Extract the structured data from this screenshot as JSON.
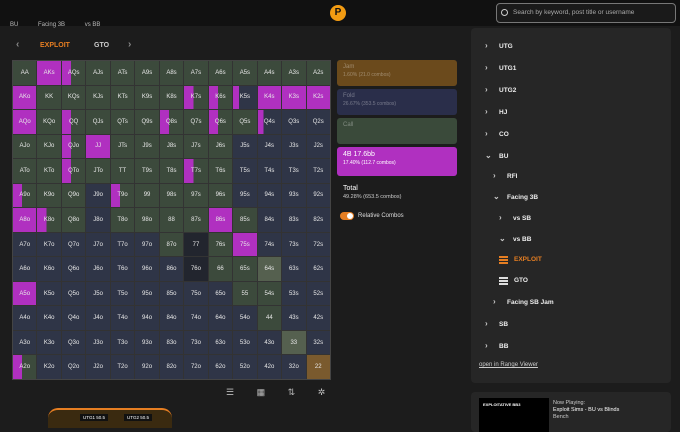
{
  "header": {
    "logo": "P",
    "search_placeholder": "Search by keyword, post title or username"
  },
  "breadcrumb": [
    "BU",
    "Facing 3B",
    "vs BB"
  ],
  "tabs": [
    "EXPLOIT",
    "GTO"
  ],
  "grid": [
    [
      "AA",
      "AKs",
      "AQs",
      "AJs",
      "ATs",
      "A9s",
      "A8s",
      "A7s",
      "A6s",
      "A5s",
      "A4s",
      "A3s",
      "A2s"
    ],
    [
      "AKo",
      "KK",
      "KQs",
      "KJs",
      "KTs",
      "K9s",
      "K8s",
      "K7s",
      "K6s",
      "K5s",
      "K4s",
      "K3s",
      "K2s"
    ],
    [
      "AQo",
      "KQo",
      "QQ",
      "QJs",
      "QTs",
      "Q9s",
      "Q8s",
      "Q7s",
      "Q6s",
      "Q5s",
      "Q4s",
      "Q3s",
      "Q2s"
    ],
    [
      "AJo",
      "KJo",
      "QJo",
      "JJ",
      "JTs",
      "J9s",
      "J8s",
      "J7s",
      "J6s",
      "J5s",
      "J4s",
      "J3s",
      "J2s"
    ],
    [
      "ATo",
      "KTo",
      "QTo",
      "JTo",
      "TT",
      "T9s",
      "T8s",
      "T7s",
      "T6s",
      "T5s",
      "T4s",
      "T3s",
      "T2s"
    ],
    [
      "A9o",
      "K9o",
      "Q9o",
      "J9o",
      "T9o",
      "99",
      "98s",
      "97s",
      "96s",
      "95s",
      "94s",
      "93s",
      "92s"
    ],
    [
      "A8o",
      "K8o",
      "Q8o",
      "J8o",
      "T8o",
      "98o",
      "88",
      "87s",
      "86s",
      "85s",
      "84s",
      "83s",
      "82s"
    ],
    [
      "A7o",
      "K7o",
      "Q7o",
      "J7o",
      "T7o",
      "97o",
      "87o",
      "77",
      "76s",
      "75s",
      "74s",
      "73s",
      "72s"
    ],
    [
      "A6o",
      "K6o",
      "Q6o",
      "J6o",
      "T6o",
      "96o",
      "86o",
      "76o",
      "66",
      "65s",
      "64s",
      "63s",
      "62s"
    ],
    [
      "A5o",
      "K5o",
      "Q5o",
      "J5o",
      "T5o",
      "95o",
      "85o",
      "75o",
      "65o",
      "55",
      "54s",
      "53s",
      "52s"
    ],
    [
      "A4o",
      "K4o",
      "Q4o",
      "J4o",
      "T4o",
      "94o",
      "84o",
      "74o",
      "64o",
      "54o",
      "44",
      "43s",
      "42s"
    ],
    [
      "A3o",
      "K3o",
      "Q3o",
      "J3o",
      "T3o",
      "93o",
      "83o",
      "73o",
      "63o",
      "53o",
      "43o",
      "33",
      "32s"
    ],
    [
      "A2o",
      "K2o",
      "Q2o",
      "J2o",
      "T2o",
      "92o",
      "82o",
      "72o",
      "62o",
      "52o",
      "42o",
      "32o",
      "22"
    ]
  ],
  "grid_colors": [
    [
      "c-call",
      "c-raise",
      "c-mix",
      "c-call",
      "c-call",
      "c-call",
      "c-call",
      "c-call",
      "c-call",
      "c-call",
      "c-call",
      "c-call",
      "c-call"
    ],
    [
      "c-raise",
      "c-call",
      "c-call",
      "c-call",
      "c-call",
      "c-call",
      "c-call",
      "c-mix",
      "c-mix",
      "c-mix2",
      "c-raise",
      "c-raise",
      "c-raise"
    ],
    [
      "c-raise",
      "c-call",
      "c-mix",
      "c-call",
      "c-call",
      "c-call",
      "c-mix",
      "c-call",
      "c-mix",
      "c-call",
      "c-mix2",
      "c-fold",
      "c-fold"
    ],
    [
      "c-call",
      "c-call",
      "c-mix",
      "c-raise",
      "c-call",
      "c-call",
      "c-call",
      "c-call",
      "c-call",
      "c-fold",
      "c-fold",
      "c-fold",
      "c-fold"
    ],
    [
      "c-call",
      "c-call",
      "c-mix",
      "c-call",
      "c-call",
      "c-call",
      "c-call",
      "c-mix",
      "c-call",
      "c-fold",
      "c-fold",
      "c-fold",
      "c-fold"
    ],
    [
      "c-mix",
      "c-call",
      "c-call",
      "c-fold",
      "c-mix",
      "c-call",
      "c-call",
      "c-call",
      "c-call",
      "c-fold",
      "c-fold",
      "c-fold",
      "c-fold"
    ],
    [
      "c-raise",
      "c-mix",
      "c-call",
      "c-fold",
      "c-call",
      "c-call",
      "c-call",
      "c-call",
      "c-raise",
      "c-call",
      "c-fold",
      "c-fold",
      "c-fold"
    ],
    [
      "c-fold",
      "c-fold",
      "c-fold",
      "c-fold",
      "c-fold",
      "c-fold",
      "c-call",
      "c-dark",
      "c-call",
      "c-raise",
      "c-fold",
      "c-fold",
      "c-fold"
    ],
    [
      "c-fold",
      "c-fold",
      "c-fold",
      "c-fold",
      "c-fold",
      "c-fold",
      "c-fold",
      "c-dark",
      "c-call",
      "c-call",
      "c-light",
      "c-fold",
      "c-fold"
    ],
    [
      "c-raise",
      "c-fold",
      "c-fold",
      "c-fold",
      "c-fold",
      "c-fold",
      "c-fold",
      "c-fold",
      "c-fold",
      "c-call",
      "c-call",
      "c-fold",
      "c-fold"
    ],
    [
      "c-fold",
      "c-fold",
      "c-fold",
      "c-fold",
      "c-fold",
      "c-fold",
      "c-fold",
      "c-fold",
      "c-fold",
      "c-fold",
      "c-call",
      "c-fold",
      "c-fold"
    ],
    [
      "c-fold",
      "c-fold",
      "c-fold",
      "c-fold",
      "c-fold",
      "c-fold",
      "c-fold",
      "c-fold",
      "c-fold",
      "c-fold",
      "c-fold",
      "c-light",
      "c-fold"
    ],
    [
      "c-mix",
      "c-fold",
      "c-fold",
      "c-fold",
      "c-fold",
      "c-fold",
      "c-fold",
      "c-fold",
      "c-fold",
      "c-fold",
      "c-fold",
      "c-fold",
      "c-orange"
    ]
  ],
  "actions": {
    "jam": {
      "label": "Jam",
      "stat": "1.60% (21.0 combos)"
    },
    "fold": {
      "label": "Fold",
      "stat": "26.67% (353.5 combos)"
    },
    "call": {
      "label": "Call",
      "stat": ""
    },
    "bet": {
      "label": "4B 17.6bb",
      "stat": "17.40% (112.7 combos)"
    }
  },
  "total": {
    "label": "Total",
    "stat": "49.28% (653.5 combos)"
  },
  "relative_combos": "Relative Combos",
  "sidebar": {
    "items": [
      {
        "label": "UTG"
      },
      {
        "label": "UTG1"
      },
      {
        "label": "UTG2"
      },
      {
        "label": "HJ"
      },
      {
        "label": "CO"
      },
      {
        "label": "BU"
      },
      {
        "label": "RFI"
      },
      {
        "label": "Facing 3B"
      },
      {
        "label": "vs SB"
      },
      {
        "label": "vs BB"
      },
      {
        "label": "EXPLOIT"
      },
      {
        "label": "GTO"
      },
      {
        "label": "Facing SB Jam"
      },
      {
        "label": "SB"
      },
      {
        "label": "BB"
      }
    ],
    "range_link": "open in Range Viewer"
  },
  "hud": {
    "left": "UTG1 50.5",
    "right": "UTG2 50.5"
  },
  "now_playing": {
    "thumb": "EXPLOITATIVE BB3",
    "label": "Now Playing:",
    "title": "Exploit Sims - BU vs Blinds",
    "author": "Bench"
  }
}
